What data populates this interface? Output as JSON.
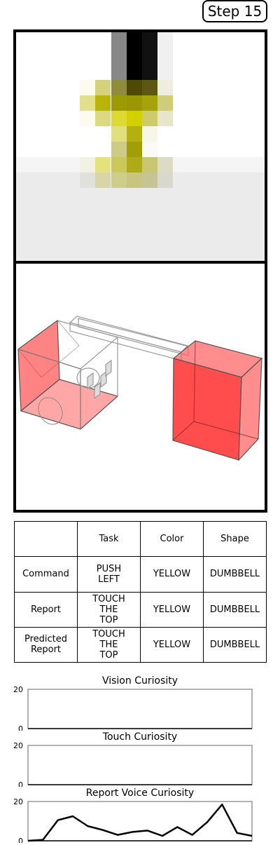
{
  "step_label": "Step 15",
  "camera_view": {
    "object_color": "yellow-dumbbell"
  },
  "render_view": {
    "box_color": "#ff4a4a"
  },
  "table": {
    "headers": [
      "",
      "Task",
      "Color",
      "Shape"
    ],
    "rows": [
      {
        "label": "Command",
        "task": "PUSH\nLEFT",
        "color": "YELLOW",
        "shape": "DUMBBELL"
      },
      {
        "label": "Report",
        "task": "TOUCH\nTHE\nTOP",
        "color": "YELLOW",
        "shape": "DUMBBELL"
      },
      {
        "label": "Predicted\nReport",
        "task": "TOUCH\nTHE\nTOP",
        "color": "YELLOW",
        "shape": "DUMBBELL"
      }
    ]
  },
  "chart_data": [
    {
      "type": "line",
      "title": "Vision Curiosity",
      "ylim": [
        0,
        20
      ],
      "yticks": [
        "20",
        "0"
      ],
      "series": [
        {
          "values": []
        }
      ]
    },
    {
      "type": "line",
      "title": "Touch Curiosity",
      "ylim": [
        0,
        20
      ],
      "yticks": [
        "20",
        "0"
      ],
      "series": [
        {
          "values": []
        }
      ]
    },
    {
      "type": "line",
      "title": "Report Voice Curiosity",
      "ylim": [
        0,
        20
      ],
      "yticks": [
        "20",
        "0"
      ],
      "series": [
        {
          "values": [
            0,
            0.5,
            10.5,
            12.5,
            7.5,
            5.5,
            3,
            4.5,
            5.2,
            2.5,
            7,
            3,
            9.5,
            18.5,
            4,
            2.5
          ]
        }
      ]
    }
  ]
}
